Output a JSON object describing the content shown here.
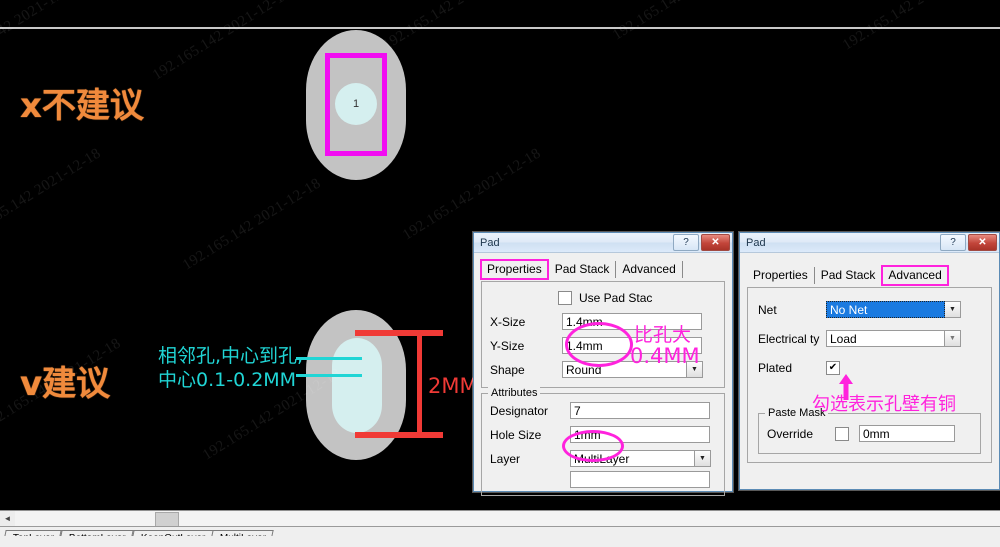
{
  "app": {
    "background_color": "#000000",
    "annotation_orange": "#f08a3c",
    "annotation_cyan": "#20d5d5",
    "annotation_magenta": "#ff22dd",
    "annotation_red": "#f03a36"
  },
  "annotations": {
    "bad_label": "x不建议",
    "good_label": "v建议",
    "spacing_line1": "相邻孔,中心到孔,",
    "spacing_line2": "中心0.1-0.2MM",
    "dimension_label": "2MM",
    "pad_bigger_line1": "比孔大",
    "pad_bigger_line2": "0.4MM",
    "plated_note": "勾选表示孔壁有铜"
  },
  "pad_graphic_top": {
    "designator_label": "1"
  },
  "dialog_properties": {
    "title": "Pad",
    "help_button": "?",
    "close_button": "✕",
    "tabs": [
      {
        "label": "Properties",
        "selected": true
      },
      {
        "label": "Pad Stack",
        "selected": false
      },
      {
        "label": "Advanced",
        "selected": false
      }
    ],
    "use_pad_stack": {
      "label": "Use Pad Stac",
      "checked": false
    },
    "fields": [
      {
        "label": "X-Size",
        "value": "1.4mm",
        "type": "text"
      },
      {
        "label": "Y-Size",
        "value": "1.4mm",
        "type": "text"
      },
      {
        "label": "Shape",
        "value": "Round",
        "type": "combo"
      }
    ],
    "attributes": {
      "group_title": "Attributes",
      "fields": [
        {
          "label": "Designator",
          "value": "7",
          "type": "text"
        },
        {
          "label": "Hole Size",
          "value": "1mm",
          "type": "text"
        },
        {
          "label": "Layer",
          "value": "MultiLayer",
          "type": "combo"
        }
      ]
    }
  },
  "dialog_advanced": {
    "title": "Pad",
    "help_button": "?",
    "close_button": "✕",
    "tabs": [
      {
        "label": "Properties",
        "selected": false
      },
      {
        "label": "Pad Stack",
        "selected": false
      },
      {
        "label": "Advanced",
        "selected": true
      }
    ],
    "fields": [
      {
        "label": "Net",
        "value": "No Net",
        "type": "combo",
        "highlighted": true
      },
      {
        "label": "Electrical ty",
        "value": "Load",
        "type": "combo",
        "highlighted": false
      }
    ],
    "plated": {
      "label": "Plated",
      "checked": true,
      "mark": "✔"
    },
    "paste_mask": {
      "group_title": "Paste Mask",
      "override_label": "Override",
      "override_checked": false,
      "value": "0mm"
    }
  },
  "bottom": {
    "scroll_left_arrow": "◄",
    "layer_tabs": [
      "TopLayer",
      "BottomLayer",
      "KeepOutLayer",
      "MultiLayer"
    ]
  },
  "watermark": {
    "text": "192.165.142  2021-12-18"
  }
}
